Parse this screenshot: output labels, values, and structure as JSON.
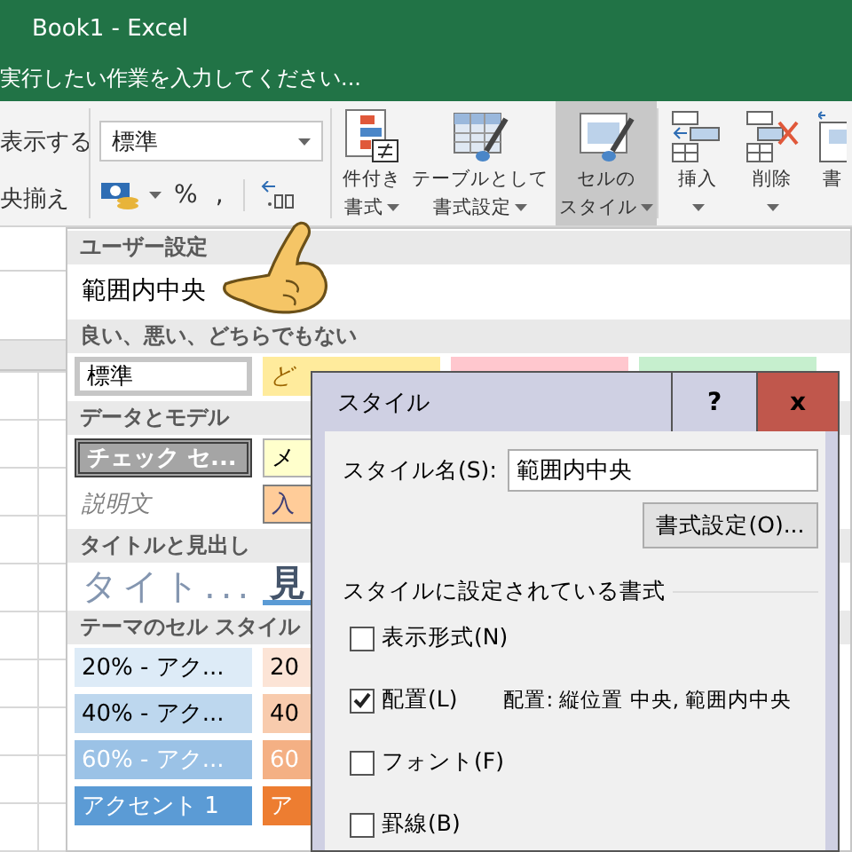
{
  "window": {
    "title": "Book1 - Excel"
  },
  "tell_me": {
    "placeholder": "実行したい作業を入力してください..."
  },
  "ribbon": {
    "wrap_text": "表示する",
    "merge_center": "央揃え",
    "number_format": {
      "value": "標準"
    },
    "number_buttons": [
      "%",
      ","
    ],
    "buttons": [
      {
        "kind": "conditional",
        "lines": [
          "件付き",
          "書式"
        ],
        "selected": false
      },
      {
        "kind": "table",
        "lines": [
          "テーブルとして",
          "書式設定"
        ],
        "selected": false
      },
      {
        "kind": "cellstyle",
        "lines": [
          "セルの",
          "スタイル"
        ],
        "selected": true
      },
      {
        "kind": "insert",
        "lines": [
          "挿入"
        ],
        "selected": false
      },
      {
        "kind": "delete",
        "lines": [
          "削除"
        ],
        "selected": false
      },
      {
        "kind": "format",
        "lines": [
          "書"
        ],
        "selected": false
      }
    ]
  },
  "gallery": {
    "sections": [
      {
        "title": "ユーザー設定",
        "rows": [
          [
            {
              "kind": "custom",
              "label": "範囲内中央"
            }
          ]
        ]
      },
      {
        "title": "良い、悪い、どちらでもない",
        "rows": [
          [
            {
              "kind": "normal",
              "label": "標準"
            },
            {
              "kind": "neutral",
              "label": "ど"
            },
            {
              "kind": "bad"
            },
            {
              "kind": "good"
            }
          ]
        ]
      },
      {
        "title": "データとモデル",
        "rows": [
          [
            {
              "kind": "check",
              "label": "チェック セ..."
            },
            {
              "kind": "note",
              "label": "メ"
            }
          ],
          [
            {
              "kind": "explanatory",
              "label": "説明文"
            },
            {
              "kind": "input",
              "label": "入"
            }
          ]
        ]
      },
      {
        "title": "タイトルと見出し",
        "rows": [
          [
            {
              "kind": "title",
              "label": "タイト..."
            },
            {
              "kind": "heading",
              "label": "見"
            }
          ]
        ]
      },
      {
        "title": "テーマのセル スタイル",
        "rows": [
          [
            {
              "kind": "blue20",
              "label": "20% - アク..."
            },
            {
              "kind": "orange20",
              "label": "20"
            }
          ],
          [
            {
              "kind": "blue40",
              "label": "40% - アク..."
            },
            {
              "kind": "orange40",
              "label": "40"
            }
          ],
          [
            {
              "kind": "blue60",
              "label": "60% - アク..."
            },
            {
              "kind": "orange60",
              "label": "60"
            }
          ],
          [
            {
              "kind": "blue100",
              "label": "アクセント 1"
            },
            {
              "kind": "orange100",
              "label": "ア"
            }
          ]
        ]
      }
    ]
  },
  "dialog": {
    "title": "スタイル",
    "help": "?",
    "close": "x",
    "name_label": "スタイル名(S):",
    "name_value": "範囲内中央",
    "format_button": "書式設定(O)...",
    "group_title": "スタイルに設定されている書式",
    "options": [
      {
        "label": "表示形式(N)",
        "checked": false
      },
      {
        "label": "配置(L)",
        "checked": true,
        "description": "配置: 縦位置 中央, 範囲内中央"
      },
      {
        "label": "フォント(F)",
        "checked": false
      },
      {
        "label": "罫線(B)",
        "checked": false
      }
    ]
  }
}
